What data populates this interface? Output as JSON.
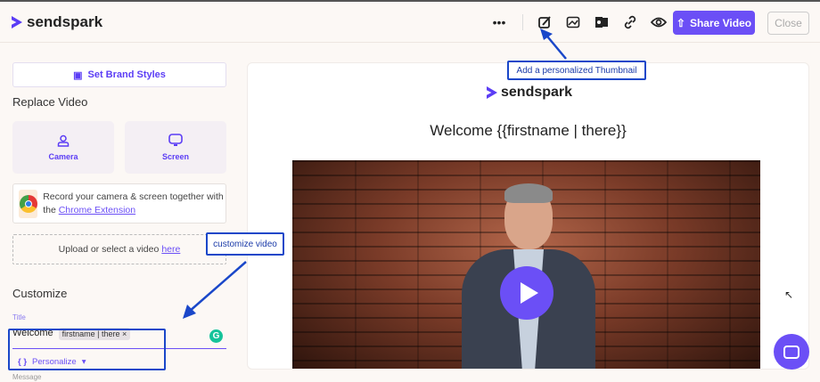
{
  "header": {
    "brand": "sendspark",
    "share_label": "Share Video",
    "close_label": "Close",
    "icons": [
      "more-icon",
      "thumbnail-edit-icon",
      "image-icon",
      "outlook-icon",
      "link-icon",
      "eye-icon"
    ]
  },
  "sidebar": {
    "brand_styles": "Set Brand Styles",
    "replace_video": "Replace Video",
    "camera": "Camera",
    "screen": "Screen",
    "extension_text": "Record your camera & screen together with the",
    "extension_link": "Chrome Extension",
    "upload_text": "Upload or select a video",
    "upload_link": "here",
    "customize": "Customize",
    "title_label": "Title",
    "title_value": "Welcome",
    "chip": "firstname | there",
    "personalize": "Personalize",
    "message_label": "Message"
  },
  "preview": {
    "brand": "sendspark",
    "title": "Welcome {{firstname | there}}"
  },
  "annotations": {
    "thumbnail": "Add a personalized Thumbnail",
    "customize": "customize video"
  },
  "colors": {
    "accent": "#6b4ff6",
    "annotation": "#1a47c9"
  }
}
